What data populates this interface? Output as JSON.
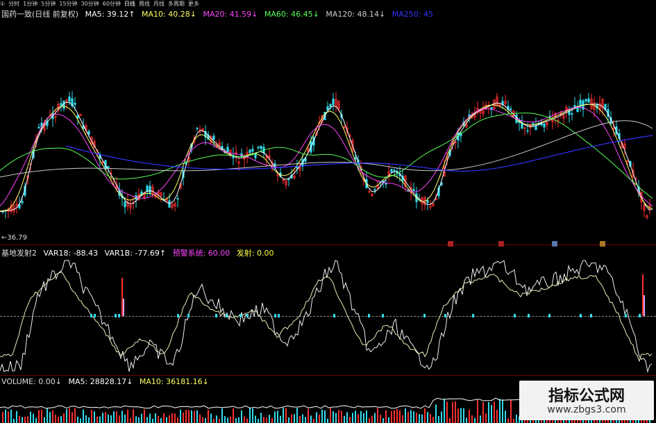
{
  "toolbar": {
    "items": [
      "①",
      "分时",
      "1分钟",
      "5分钟",
      "15分钟",
      "30分钟",
      "60分钟",
      "日线",
      "周线",
      "月线",
      "多周期",
      "更多"
    ],
    "active_index": 7
  },
  "main_header": {
    "stock": "国药一致(日线 前复权)",
    "ma5": "MA5: 39.12↑",
    "ma10": "MA10: 40.28↓",
    "ma20": "MA20: 41.59↓",
    "ma60": "MA60: 46.45↓",
    "ma120": "MA120: 48.14↓",
    "ma250": "MA250: 45",
    "low_label": "←36.79"
  },
  "indicator_header": {
    "name": "基地发射2",
    "var18": "VAR18: -88.43",
    "var1b": "VAR1B: -77.69↑",
    "warning": "预警系统: 60.00",
    "launch": "发射: 0.00"
  },
  "volume_header": {
    "volume": "VOLUME: 0.00↓",
    "ma5": "MA5: 28828.17↓",
    "ma10": "MA10: 36181.16↓"
  },
  "watermark": {
    "title": "指标公式网",
    "url": "www.zbgs3.com"
  },
  "colors": {
    "ma5": "#ffffff",
    "ma10": "#ffff66",
    "ma20": "#ff44ff",
    "ma60": "#55ff55",
    "ma120": "#cccccc",
    "ma250": "#3333ff",
    "up": "#ff3030",
    "down": "#33ddee",
    "warn": "#ff44ff",
    "launch": "#ffff44"
  }
}
